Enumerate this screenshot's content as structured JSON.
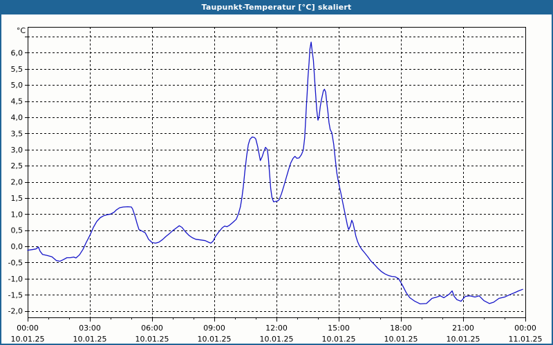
{
  "window": {
    "title": "Taupunkt-Temperatur [°C] skaliert"
  },
  "chart_data": {
    "type": "line",
    "title": "Taupunkt-Temperatur [°C] skaliert",
    "unit_label": "°C",
    "grid": {
      "style": "dashed",
      "color": "#000000",
      "h_step_deg": 0.5,
      "v_step_hours": 3
    },
    "colors": {
      "titlebar": "#1f6496",
      "border": "#1f6496",
      "line": "#1414c8",
      "frame": "#000000"
    },
    "y_axis": {
      "top_value": 6.8,
      "bottom_value": -2.2,
      "grid_top": 6.5,
      "grid_bottom": -2.0,
      "step": 0.5,
      "ticks": [
        {
          "label": "6,0",
          "value": 6
        },
        {
          "label": "5,5",
          "value": 5.5
        },
        {
          "label": "5,0",
          "value": 5
        },
        {
          "label": "4,5",
          "value": 4.5
        },
        {
          "label": "4,0",
          "value": 4
        },
        {
          "label": "3,5",
          "value": 3.5
        },
        {
          "label": "3,0",
          "value": 3
        },
        {
          "label": "2,5",
          "value": 2.5
        },
        {
          "label": "2,0",
          "value": 2
        },
        {
          "label": "1,5",
          "value": 1.5
        },
        {
          "label": "1,0",
          "value": 1
        },
        {
          "label": "0,5",
          "value": 0.5
        },
        {
          "label": "0,0",
          "value": 0
        },
        {
          "label": "-0,5",
          "value": -0.5
        },
        {
          "label": "-1,0",
          "value": -1
        },
        {
          "label": "-1,5",
          "value": -1.5
        },
        {
          "label": "-2,0",
          "value": -2
        }
      ]
    },
    "x_axis": {
      "range_hours": [
        0,
        24
      ],
      "minor_tick_hours": 1,
      "major_tick_hours": 3,
      "ticks": [
        {
          "hour": 0,
          "time": "00:00",
          "date": "10.01.25"
        },
        {
          "hour": 3,
          "time": "03:00",
          "date": "10.01.25"
        },
        {
          "hour": 6,
          "time": "06:00",
          "date": "10.01.25"
        },
        {
          "hour": 9,
          "time": "09:00",
          "date": "10.01.25"
        },
        {
          "hour": 12,
          "time": "12:00",
          "date": "10.01.25"
        },
        {
          "hour": 15,
          "time": "15:00",
          "date": "10.01.25"
        },
        {
          "hour": 18,
          "time": "18:00",
          "date": "10.01.25"
        },
        {
          "hour": 21,
          "time": "21:00",
          "date": "10.01.25"
        },
        {
          "hour": 24,
          "time": "00:00",
          "date": "11.01.25"
        }
      ]
    },
    "series": [
      {
        "name": "Taupunkt-Temperatur",
        "color": "#1414c8",
        "points": [
          [
            0,
            -0.12
          ],
          [
            0.2,
            -0.1
          ],
          [
            0.4,
            -0.08
          ],
          [
            0.52,
            -0.02
          ],
          [
            0.6,
            -0.15
          ],
          [
            0.72,
            -0.25
          ],
          [
            0.94,
            -0.28
          ],
          [
            1.17,
            -0.32
          ],
          [
            1.39,
            -0.44
          ],
          [
            1.56,
            -0.46
          ],
          [
            1.72,
            -0.41
          ],
          [
            1.89,
            -0.35
          ],
          [
            2.06,
            -0.35
          ],
          [
            2.22,
            -0.33
          ],
          [
            2.33,
            -0.36
          ],
          [
            2.5,
            -0.26
          ],
          [
            2.67,
            -0.09
          ],
          [
            2.83,
            0.13
          ],
          [
            3,
            0.34
          ],
          [
            3.17,
            0.59
          ],
          [
            3.33,
            0.77
          ],
          [
            3.5,
            0.89
          ],
          [
            3.67,
            0.95
          ],
          [
            3.83,
            0.98
          ],
          [
            4,
            1
          ],
          [
            4.17,
            1.06
          ],
          [
            4.28,
            1.13
          ],
          [
            4.44,
            1.2
          ],
          [
            4.61,
            1.22
          ],
          [
            4.83,
            1.23
          ],
          [
            5,
            1.22
          ],
          [
            5.06,
            1.16
          ],
          [
            5.17,
            0.95
          ],
          [
            5.28,
            0.7
          ],
          [
            5.37,
            0.52
          ],
          [
            5.5,
            0.48
          ],
          [
            5.67,
            0.42
          ],
          [
            5.77,
            0.3
          ],
          [
            5.83,
            0.22
          ],
          [
            6,
            0.12
          ],
          [
            6.17,
            0.1
          ],
          [
            6.33,
            0.13
          ],
          [
            6.5,
            0.21
          ],
          [
            6.67,
            0.31
          ],
          [
            6.83,
            0.39
          ],
          [
            7,
            0.49
          ],
          [
            7.17,
            0.57
          ],
          [
            7.31,
            0.64
          ],
          [
            7.44,
            0.59
          ],
          [
            7.61,
            0.45
          ],
          [
            7.78,
            0.34
          ],
          [
            7.94,
            0.27
          ],
          [
            8.11,
            0.22
          ],
          [
            8.33,
            0.2
          ],
          [
            8.56,
            0.18
          ],
          [
            8.72,
            0.13
          ],
          [
            8.83,
            0.1
          ],
          [
            8.94,
            0.16
          ],
          [
            9.06,
            0.31
          ],
          [
            9.22,
            0.45
          ],
          [
            9.39,
            0.58
          ],
          [
            9.5,
            0.63
          ],
          [
            9.61,
            0.61
          ],
          [
            9.72,
            0.65
          ],
          [
            9.89,
            0.74
          ],
          [
            10.06,
            0.84
          ],
          [
            10.17,
            1.02
          ],
          [
            10.26,
            1.23
          ],
          [
            10.33,
            1.5
          ],
          [
            10.4,
            1.85
          ],
          [
            10.47,
            2.3
          ],
          [
            10.56,
            2.8
          ],
          [
            10.64,
            3.15
          ],
          [
            10.72,
            3.32
          ],
          [
            10.83,
            3.39
          ],
          [
            10.94,
            3.37
          ],
          [
            11,
            3.33
          ],
          [
            11.09,
            3.1
          ],
          [
            11.17,
            2.83
          ],
          [
            11.22,
            2.66
          ],
          [
            11.31,
            2.78
          ],
          [
            11.39,
            2.94
          ],
          [
            11.47,
            3.07
          ],
          [
            11.56,
            3
          ],
          [
            11.61,
            2.72
          ],
          [
            11.67,
            2.22
          ],
          [
            11.72,
            1.8
          ],
          [
            11.78,
            1.52
          ],
          [
            11.86,
            1.38
          ],
          [
            11.94,
            1.39
          ],
          [
            12.06,
            1.41
          ],
          [
            12.13,
            1.45
          ],
          [
            12.24,
            1.63
          ],
          [
            12.36,
            1.88
          ],
          [
            12.47,
            2.13
          ],
          [
            12.58,
            2.37
          ],
          [
            12.69,
            2.59
          ],
          [
            12.8,
            2.73
          ],
          [
            12.89,
            2.79
          ],
          [
            12.98,
            2.73
          ],
          [
            13.09,
            2.74
          ],
          [
            13.2,
            2.84
          ],
          [
            13.29,
            2.98
          ],
          [
            13.36,
            3.37
          ],
          [
            13.41,
            3.97
          ],
          [
            13.44,
            4.33
          ],
          [
            13.48,
            4.76
          ],
          [
            13.52,
            5.26
          ],
          [
            13.57,
            5.69
          ],
          [
            13.61,
            6.11
          ],
          [
            13.67,
            6.33
          ],
          [
            13.72,
            6.05
          ],
          [
            13.78,
            5.76
          ],
          [
            13.83,
            5.26
          ],
          [
            13.89,
            4.69
          ],
          [
            13.94,
            4.23
          ],
          [
            14,
            3.91
          ],
          [
            14.06,
            4.05
          ],
          [
            14.11,
            4.33
          ],
          [
            14.17,
            4.55
          ],
          [
            14.26,
            4.82
          ],
          [
            14.31,
            4.87
          ],
          [
            14.37,
            4.78
          ],
          [
            14.42,
            4.48
          ],
          [
            14.48,
            4.16
          ],
          [
            14.53,
            3.84
          ],
          [
            14.59,
            3.62
          ],
          [
            14.67,
            3.52
          ],
          [
            14.76,
            3.16
          ],
          [
            14.83,
            2.73
          ],
          [
            14.91,
            2.27
          ],
          [
            14.98,
            2.02
          ],
          [
            15.03,
            1.87
          ],
          [
            15.11,
            1.63
          ],
          [
            15.2,
            1.34
          ],
          [
            15.28,
            1.09
          ],
          [
            15.36,
            0.84
          ],
          [
            15.42,
            0.65
          ],
          [
            15.48,
            0.52
          ],
          [
            15.56,
            0.63
          ],
          [
            15.63,
            0.81
          ],
          [
            15.69,
            0.72
          ],
          [
            15.76,
            0.52
          ],
          [
            15.83,
            0.31
          ],
          [
            15.91,
            0.15
          ],
          [
            16,
            0.02
          ],
          [
            16.11,
            -0.09
          ],
          [
            16.24,
            -0.19
          ],
          [
            16.39,
            -0.31
          ],
          [
            16.56,
            -0.46
          ],
          [
            16.72,
            -0.56
          ],
          [
            16.89,
            -0.68
          ],
          [
            17.06,
            -0.78
          ],
          [
            17.22,
            -0.85
          ],
          [
            17.39,
            -0.9
          ],
          [
            17.56,
            -0.93
          ],
          [
            17.72,
            -0.94
          ],
          [
            17.89,
            -1
          ],
          [
            18.07,
            -1.2
          ],
          [
            18.27,
            -1.45
          ],
          [
            18.43,
            -1.59
          ],
          [
            18.67,
            -1.7
          ],
          [
            18.93,
            -1.78
          ],
          [
            19.23,
            -1.77
          ],
          [
            19.5,
            -1.61
          ],
          [
            19.73,
            -1.57
          ],
          [
            19.9,
            -1.53
          ],
          [
            20.07,
            -1.59
          ],
          [
            20.33,
            -1.48
          ],
          [
            20.47,
            -1.38
          ],
          [
            20.57,
            -1.55
          ],
          [
            20.7,
            -1.65
          ],
          [
            20.9,
            -1.7
          ],
          [
            21.1,
            -1.55
          ],
          [
            21.33,
            -1.53
          ],
          [
            21.57,
            -1.57
          ],
          [
            21.77,
            -1.53
          ],
          [
            22,
            -1.68
          ],
          [
            22.27,
            -1.77
          ],
          [
            22.47,
            -1.73
          ],
          [
            22.73,
            -1.61
          ],
          [
            23,
            -1.57
          ],
          [
            23.23,
            -1.5
          ],
          [
            23.47,
            -1.44
          ],
          [
            23.67,
            -1.38
          ],
          [
            23.87,
            -1.33
          ]
        ]
      }
    ]
  }
}
